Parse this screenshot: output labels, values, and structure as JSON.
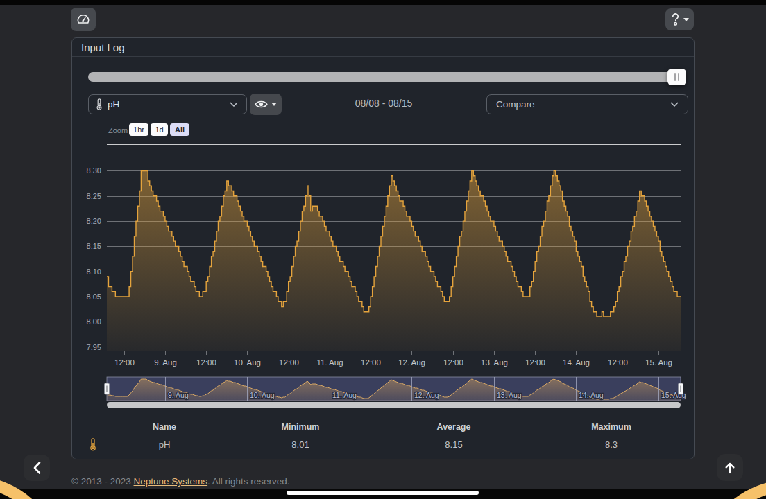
{
  "toolbar": {
    "dashboard_button_icon": "gauge-icon",
    "help_button_icon": "question-icon"
  },
  "card": {
    "title": "Input Log"
  },
  "controls": {
    "input_select": {
      "icon": "thermometer-icon",
      "value": "pH"
    },
    "visibility_button_icon": "eye-icon",
    "date_range": "08/08 - 08/15",
    "compare_select": {
      "placeholder": "Compare"
    }
  },
  "chart_data": {
    "type": "area",
    "step": true,
    "series": [
      {
        "name": "pH",
        "color": "#e5a43d",
        "start": "08/08 07:00",
        "interval_minutes": 30,
        "values": [
          8.09,
          8.07,
          8.07,
          8.06,
          8.06,
          8.05,
          8.05,
          8.05,
          8.05,
          8.05,
          8.05,
          8.05,
          8.05,
          8.07,
          8.1,
          8.13,
          8.17,
          8.2,
          8.23,
          8.26,
          8.3,
          8.3,
          8.3,
          8.3,
          8.28,
          8.27,
          8.26,
          8.25,
          8.25,
          8.24,
          8.23,
          8.22,
          8.22,
          8.21,
          8.2,
          8.19,
          8.18,
          8.18,
          8.17,
          8.16,
          8.15,
          8.15,
          8.14,
          8.13,
          8.12,
          8.11,
          8.11,
          8.1,
          8.09,
          8.08,
          8.08,
          8.07,
          8.06,
          8.06,
          8.05,
          8.05,
          8.06,
          8.06,
          8.08,
          8.09,
          8.11,
          8.13,
          8.14,
          8.16,
          8.18,
          8.2,
          8.21,
          8.23,
          8.25,
          8.26,
          8.28,
          8.27,
          8.27,
          8.26,
          8.25,
          8.25,
          8.24,
          8.23,
          8.22,
          8.21,
          8.2,
          8.2,
          8.19,
          8.18,
          8.17,
          8.16,
          8.15,
          8.15,
          8.14,
          8.13,
          8.12,
          8.11,
          8.11,
          8.1,
          8.09,
          8.08,
          8.07,
          8.06,
          8.06,
          8.05,
          8.04,
          8.04,
          8.03,
          8.04,
          8.04,
          8.06,
          8.08,
          8.09,
          8.11,
          8.13,
          8.15,
          8.16,
          8.18,
          8.2,
          8.22,
          8.23,
          8.25,
          8.27,
          8.25,
          8.22,
          8.23,
          8.23,
          8.23,
          8.22,
          8.21,
          8.21,
          8.2,
          8.19,
          8.18,
          8.18,
          8.17,
          8.16,
          8.15,
          8.15,
          8.14,
          8.13,
          8.12,
          8.12,
          8.11,
          8.1,
          8.1,
          8.09,
          8.08,
          8.07,
          8.07,
          8.06,
          8.05,
          8.04,
          8.04,
          8.03,
          8.02,
          8.02,
          8.02,
          8.03,
          8.05,
          8.07,
          8.09,
          8.11,
          8.13,
          8.15,
          8.17,
          8.19,
          8.21,
          8.23,
          8.25,
          8.27,
          8.29,
          8.28,
          8.27,
          8.26,
          8.25,
          8.24,
          8.24,
          8.23,
          8.22,
          8.21,
          8.21,
          8.2,
          8.19,
          8.18,
          8.17,
          8.17,
          8.16,
          8.15,
          8.14,
          8.14,
          8.13,
          8.12,
          8.11,
          8.1,
          8.1,
          8.09,
          8.08,
          8.07,
          8.07,
          8.06,
          8.05,
          8.04,
          8.04,
          8.04,
          8.05,
          8.07,
          8.09,
          8.11,
          8.13,
          8.15,
          8.17,
          8.18,
          8.2,
          8.22,
          8.24,
          8.26,
          8.28,
          8.3,
          8.29,
          8.28,
          8.27,
          8.26,
          8.25,
          8.25,
          8.24,
          8.23,
          8.22,
          8.21,
          8.2,
          8.2,
          8.19,
          8.18,
          8.17,
          8.16,
          8.16,
          8.15,
          8.14,
          8.13,
          8.12,
          8.12,
          8.11,
          8.1,
          8.09,
          8.08,
          8.07,
          8.07,
          8.06,
          8.05,
          8.05,
          8.05,
          8.05,
          8.07,
          8.08,
          8.1,
          8.12,
          8.14,
          8.15,
          8.17,
          8.19,
          8.2,
          8.22,
          8.24,
          8.25,
          8.27,
          8.29,
          8.3,
          8.29,
          8.28,
          8.27,
          8.26,
          8.24,
          8.23,
          8.22,
          8.21,
          8.19,
          8.18,
          8.17,
          8.16,
          8.14,
          8.13,
          8.12,
          8.11,
          8.09,
          8.08,
          8.07,
          8.06,
          8.04,
          8.03,
          8.02,
          8.02,
          8.01,
          8.01,
          8.01,
          8.02,
          8.01,
          8.01,
          8.01,
          8.01,
          8.02,
          8.02,
          8.03,
          8.04,
          8.06,
          8.07,
          8.09,
          8.1,
          8.12,
          8.13,
          8.15,
          8.16,
          8.18,
          8.19,
          8.21,
          8.22,
          8.24,
          8.26,
          8.25,
          8.25,
          8.24,
          8.23,
          8.22,
          8.21,
          8.2,
          8.19,
          8.18,
          8.17,
          8.16,
          8.14,
          8.13,
          8.12,
          8.11,
          8.1,
          8.09,
          8.08,
          8.07,
          8.06,
          8.06,
          8.05,
          8.05,
          8.05
        ]
      }
    ],
    "ylim": [
      7.95,
      8.353
    ],
    "yticks": [
      "8.30",
      "8.25",
      "8.20",
      "8.15",
      "8.10",
      "8.05",
      "8.00",
      "7.95"
    ],
    "xticks": [
      {
        "t": 5,
        "label": "12:00"
      },
      {
        "t": 17,
        "label": "9. Aug"
      },
      {
        "t": 29,
        "label": "12:00"
      },
      {
        "t": 41,
        "label": "10. Aug"
      },
      {
        "t": 53,
        "label": "12:00"
      },
      {
        "t": 65,
        "label": "11. Aug"
      },
      {
        "t": 77,
        "label": "12:00"
      },
      {
        "t": 89,
        "label": "12. Aug"
      },
      {
        "t": 101,
        "label": "12:00"
      },
      {
        "t": 113,
        "label": "13. Aug"
      },
      {
        "t": 125,
        "label": "12:00"
      },
      {
        "t": 137,
        "label": "14. Aug"
      },
      {
        "t": 149,
        "label": "12:00"
      },
      {
        "t": 161,
        "label": "15. Aug"
      }
    ],
    "zoom": {
      "label": "Zoom",
      "options": [
        "1hr",
        "1d",
        "All"
      ],
      "selected": "All"
    },
    "navigator": {
      "day_labels": [
        {
          "t": 17,
          "label": "9. Aug"
        },
        {
          "t": 41,
          "label": "10. Aug"
        },
        {
          "t": 65,
          "label": "11. Aug"
        },
        {
          "t": 89,
          "label": "12. Aug"
        },
        {
          "t": 113,
          "label": "13. Aug"
        },
        {
          "t": 137,
          "label": "14. Aug"
        },
        {
          "t": 161,
          "label": "15. Aug"
        }
      ]
    },
    "legend": "off",
    "grid": "horizontal"
  },
  "table": {
    "headers": [
      "Name",
      "Minimum",
      "Average",
      "Maximum"
    ],
    "rows": [
      {
        "icon": "thermometer-icon",
        "name": "pH",
        "minimum": "8.01",
        "average": "8.15",
        "maximum": "8.3"
      }
    ]
  },
  "footer": {
    "copyright_prefix": "© 2013 - 2023 ",
    "link_text": "Neptune Systems",
    "suffix": ". All rights reserved."
  },
  "colors": {
    "page_bg": "#26272b",
    "card_bg": "#20242b",
    "series": "#e5a43d",
    "navigator_mask": "#3a3f5d",
    "accent_link": "#e8bc7b",
    "ring": "#f6c169"
  }
}
